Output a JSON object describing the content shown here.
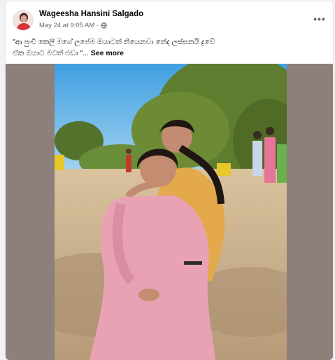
{
  "post": {
    "author": "Wageesha Hansini Salgado",
    "timestamp": "May 24 at 9:05 AM",
    "dot": "·",
    "privacy_icon": "globe-icon",
    "more_icon": "ellipsis-icon",
    "more_label": "•••",
    "caption_text": "\"ආ පුංචි කෙලි මගේ ලපේම ඔයාටත් තියෙනවා නේද ලස්සනයි දුවේ ඒක ඔයාට මටත් එඩා \"...",
    "see_more": "See more"
  },
  "colors": {
    "author": "#050505",
    "meta": "#65676b",
    "media_background": "#8d7f79",
    "page_background": "#f0f2f5"
  }
}
